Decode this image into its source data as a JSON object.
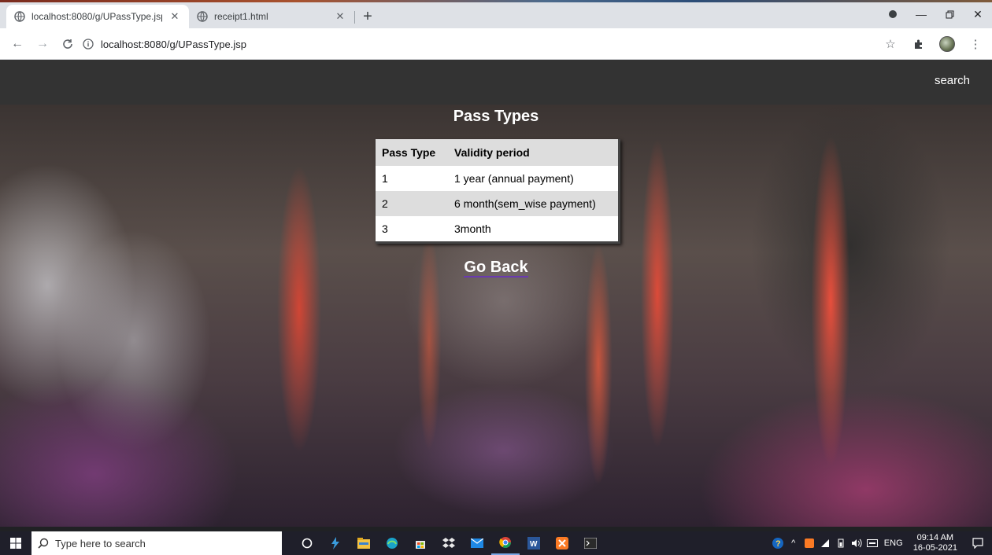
{
  "browser": {
    "tabs": [
      {
        "title": "localhost:8080/g/UPassType.jsp",
        "active": true
      },
      {
        "title": "receipt1.html",
        "active": false
      }
    ],
    "address": "localhost:8080/g/UPassType.jsp"
  },
  "navbar": {
    "search_label": "search"
  },
  "page": {
    "title": "Pass Types",
    "table": {
      "headers": [
        "Pass Type",
        "Validity period"
      ],
      "rows": [
        [
          "1",
          "1 year (annual payment)"
        ],
        [
          "2",
          "6 month(sem_wise payment)"
        ],
        [
          "3",
          "3month"
        ]
      ]
    },
    "go_back_label": "Go Back"
  },
  "taskbar": {
    "search_placeholder": "Type here to search",
    "language": "ENG",
    "time": "09:14 AM",
    "date": "16-05-2021"
  },
  "colors": {
    "navbar_bg": "#333333",
    "table_header_bg": "#dddddd",
    "link_underline": "#6a3ab0"
  }
}
